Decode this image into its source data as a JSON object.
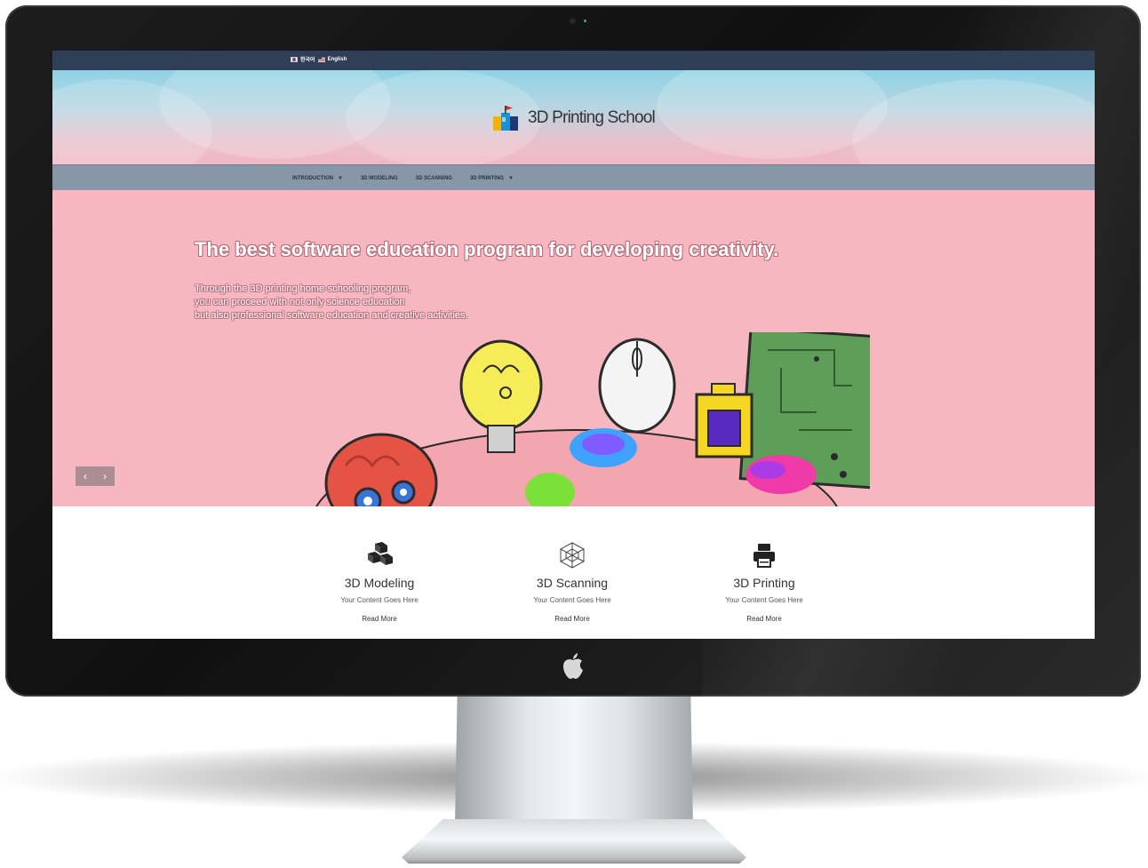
{
  "topbar": {
    "languages": [
      {
        "label": "한국어",
        "flag": "kr"
      },
      {
        "label": "English",
        "flag": "us"
      }
    ]
  },
  "header": {
    "logo_text": "3D Printing School"
  },
  "nav": {
    "items": [
      {
        "label": "INTRODUCTION",
        "dropdown": true
      },
      {
        "label": "3D MODELING",
        "dropdown": false
      },
      {
        "label": "3D SCANNING",
        "dropdown": false
      },
      {
        "label": "3D PRINTING",
        "dropdown": true
      }
    ]
  },
  "hero": {
    "title": "The best software education program for developing creativity.",
    "subtitle_lines": [
      "Through the 3D printing home-schooling program,",
      "you can proceed with not only science education",
      "but also professional software education and creative activities."
    ],
    "prev_icon": "chevron-left-icon",
    "next_icon": "chevron-right-icon"
  },
  "features": [
    {
      "icon": "cubes-icon",
      "title": "3D Modeling",
      "text": "Your Content Goes Here",
      "link": "Read More"
    },
    {
      "icon": "mesh-icon",
      "title": "3D Scanning",
      "text": "Your Content Goes Here",
      "link": "Read More"
    },
    {
      "icon": "printer-icon",
      "title": "3D Printing",
      "text": "Your Content Goes Here",
      "link": "Read More"
    }
  ],
  "colors": {
    "topbar": "#2e3f57",
    "nav": "#8797a8",
    "hero_bg": "#f7b7c0",
    "bezel": "#111111"
  }
}
